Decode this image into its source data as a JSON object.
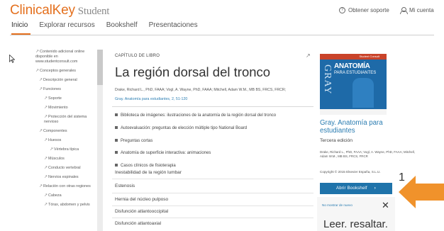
{
  "header": {
    "logo": "ClinicalKey",
    "logo_suffix": "Student",
    "support_label": "Obtener soporte",
    "account_label": "Mi cuenta"
  },
  "nav": {
    "items": [
      "Inicio",
      "Explorar recursos",
      "Bookshelf",
      "Presentaciones"
    ],
    "active": "Inicio"
  },
  "toc": {
    "items": [
      "Contenido adicional online disponible en www.studentconsult.com",
      "Conceptos generales",
      "Descripción general",
      "Funciones",
      "Soporte",
      "Movimiento",
      "Protección del sistema nervioso",
      "Componentes",
      "Huesos",
      "Vértebra típica",
      "Músculos",
      "Conducto vertebral",
      "Nervios espinales",
      "Relación con otras regiones",
      "Cabeza",
      "Tórax, abdomen y pelvis"
    ]
  },
  "main": {
    "kicker": "CAPÍTULO DE LIBRO",
    "title": "La región dorsal del tronco",
    "authors": "Drake, Richard L., PhD, FAAA; Vogl, A. Wayne, PhD, FAAA; Mitchell, Adam W.M., MB BS, FRCS, FRCR;",
    "source": "Gray. Anatomía para estudiantes, 2, 51-120",
    "resources": [
      "Biblioteca de imágenes: ilustraciones de la anatomía de la región dorsal del tronco",
      "Autoevaluación: preguntas de elección múltiple tipo National Board",
      "Preguntas cortas",
      "Anatomía de superficie interactiva: animaciones",
      "Casos clínicos de fisioterapia"
    ],
    "sections": [
      "Inestabilidad de la región lumbar",
      "Estenosis",
      "Hernia del núcleo pulposo",
      "Disfunción atlantooccipital",
      "Disfunción atlantoaxial"
    ]
  },
  "book": {
    "cover_brand": "Student Consult",
    "cover_series": "GRAY",
    "cover_title": "ANATOMÍA",
    "cover_subtitle": "PARA ESTUDIANTES",
    "title": "Gray. Anatomía para estudiantes",
    "edition": "Tercera edición",
    "authors": "Drake, Richard L., PhD, FAAA; Vogl, A. Wayne, PhD, FAAA; Mitchell, Adam W.M., MB BS, FRCS, FRCR",
    "copyright": "Copyright © 2015 Elsevier España, S.L.U.",
    "open_button": "Abrir Bookshelf"
  },
  "ad": {
    "dismiss": "No mostrar de nuevo",
    "text": "Leer. resaltar."
  },
  "callout": {
    "number": "1",
    "color": "#f0922b"
  },
  "colors": {
    "accent": "#e4701e",
    "link": "#2a7cb1",
    "button": "#1f73aa"
  }
}
